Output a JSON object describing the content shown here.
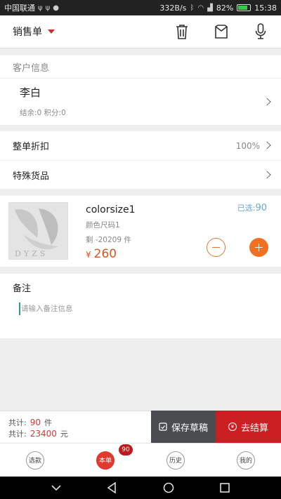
{
  "status_bar": {
    "carrier": "中国联通",
    "speed": "332B/s",
    "battery": "82%",
    "battery_level": 0.82,
    "time": "15:38"
  },
  "header": {
    "title": "销售单",
    "icons": [
      "trash-icon",
      "bag-icon",
      "microphone-icon"
    ]
  },
  "customer": {
    "section_title": "客户信息",
    "name": "李白",
    "balance_points": "结余:0 积分:0"
  },
  "order_options": {
    "discount_label": "整单折扣",
    "discount_value": "100%",
    "special_goods_label": "特殊货品"
  },
  "item": {
    "name": "colorsize1",
    "spec": "颜色尺码1",
    "stock": "剩 -20209 件",
    "price_symbol": "¥",
    "price": "260",
    "selected_label": "已选:",
    "selected_count": "90"
  },
  "remark": {
    "label": "备注",
    "placeholder": "请输入备注信息"
  },
  "footer": {
    "qty_label": "共计:",
    "qty_value": "90",
    "qty_unit": "件",
    "amount_label": "共计:",
    "amount_value": "23400",
    "amount_unit": "元",
    "save_draft": "保存草稿",
    "checkout": "去结算"
  },
  "tabs": [
    {
      "label": "选款"
    },
    {
      "label": "本单",
      "badge": "90"
    },
    {
      "label": "历史"
    },
    {
      "label": "我的"
    }
  ],
  "colors": {
    "accent_red": "#cc1f24",
    "price_orange": "#e0531f",
    "selected_blue": "#6aa6d8"
  }
}
